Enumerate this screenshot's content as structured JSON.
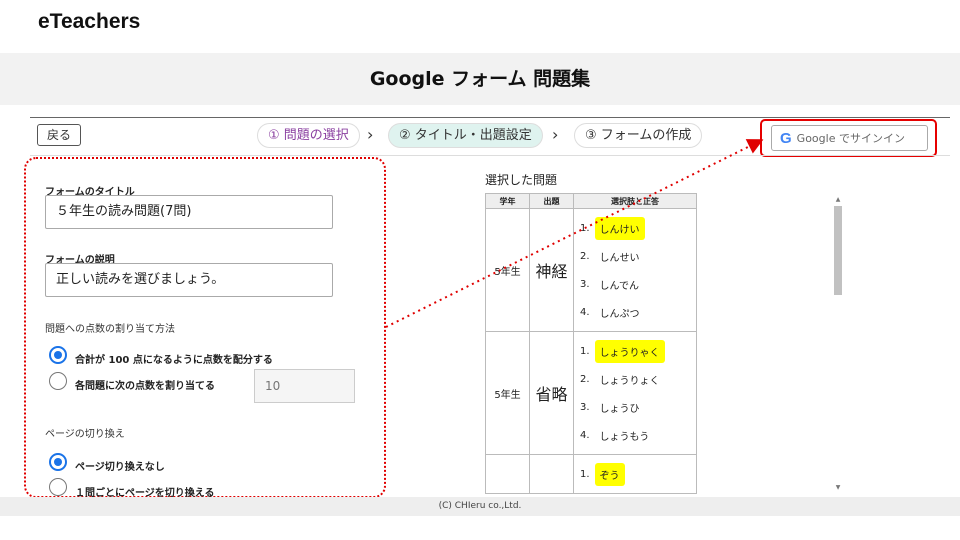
{
  "brand": "eTeachers",
  "page_title": "Google フォーム 問題集",
  "toolbar": {
    "back_label": "戻る",
    "steps": [
      {
        "label": "① 問題の選択"
      },
      {
        "label": "② タイトル・出題設定"
      },
      {
        "label": "③ フォームの作成"
      }
    ],
    "separator": "›",
    "signin": {
      "g": "G",
      "label": "Google でサインイン"
    }
  },
  "form": {
    "title_label": "フォームのタイトル",
    "title_value": "５年生の読み問題(7問)",
    "desc_label": "フォームの説明",
    "desc_value": "正しい読みを選びましょう。",
    "points_label": "問題への点数の割り当て方法",
    "points_options": [
      {
        "label": "合計が 100 点になるように点数を配分する",
        "selected": true
      },
      {
        "label": "各問題に次の点数を割り当てる",
        "selected": false
      }
    ],
    "points_value": "10",
    "page_label": "ページの切り換え",
    "page_options": [
      {
        "label": "ページ切り換えなし",
        "selected": true
      },
      {
        "label": "１問ごとにページを切り換える",
        "selected": false
      }
    ]
  },
  "selected": {
    "heading": "選択した問題",
    "columns": [
      "学年",
      "出題",
      "選択肢と正答"
    ],
    "rows": [
      {
        "grade": "5年生",
        "word": "神経",
        "choices": [
          {
            "num": "1.",
            "text": "しんけい",
            "correct": true
          },
          {
            "num": "2.",
            "text": "しんせい",
            "correct": false
          },
          {
            "num": "3.",
            "text": "しんでん",
            "correct": false
          },
          {
            "num": "4.",
            "text": "しんぷつ",
            "correct": false
          }
        ]
      },
      {
        "grade": "5年生",
        "word": "省略",
        "choices": [
          {
            "num": "1.",
            "text": "しょうりゃく",
            "correct": true
          },
          {
            "num": "2.",
            "text": "しょうりょく",
            "correct": false
          },
          {
            "num": "3.",
            "text": "しょうひ",
            "correct": false
          },
          {
            "num": "4.",
            "text": "しょうもう",
            "correct": false
          }
        ]
      },
      {
        "grade": "",
        "word": "",
        "choices": [
          {
            "num": "1.",
            "text": "ぞう",
            "correct": true
          }
        ]
      }
    ]
  },
  "footer": "(C) CHIeru co.,Ltd.",
  "colors": {
    "accent": "#1a73e8",
    "highlight": "#ffff00",
    "annotation": "#e00000",
    "step_active": "#dff3ef"
  }
}
